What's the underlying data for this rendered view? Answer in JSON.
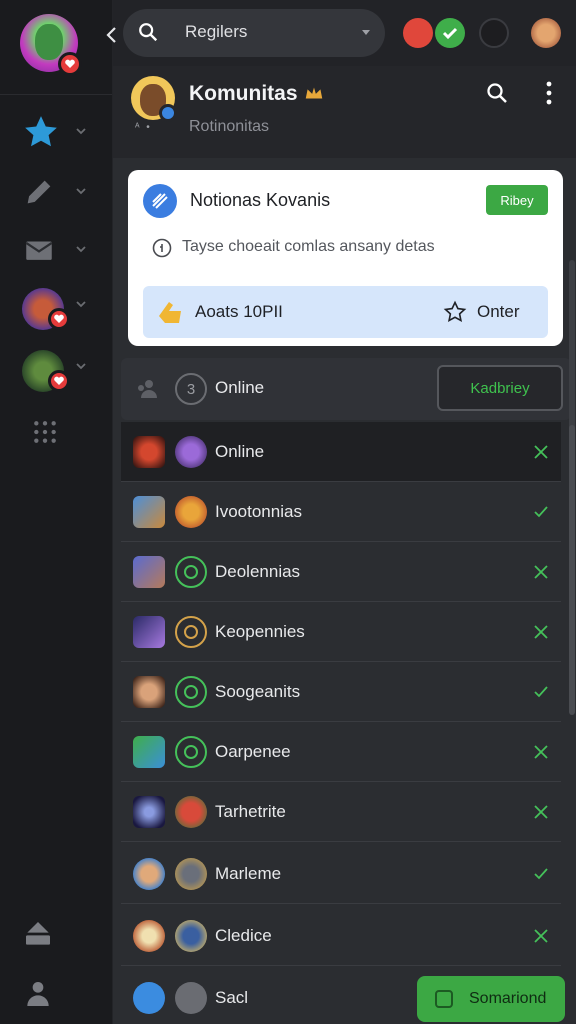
{
  "header": {
    "search_text": "Regilers"
  },
  "community": {
    "title": "Komunitas",
    "subtitle": "Rotinonitas",
    "avatar_dots": "ᴬ •"
  },
  "notification": {
    "title": "Notionas Kovanis",
    "button_label": "Ribey",
    "description": "Tayse choeait comlas ansany detas",
    "bar_left": "Aoats 10PII",
    "bar_right": "Onter"
  },
  "list_header": {
    "circle_number": "3",
    "label": "Online",
    "button_label": "Kadbriey"
  },
  "rows": [
    {
      "name": "Online"
    },
    {
      "name": "Ivootonnias"
    },
    {
      "name": "Deolennias"
    },
    {
      "name": "Keopennies"
    },
    {
      "name": "Soogeanits"
    },
    {
      "name": "Oarpenee"
    },
    {
      "name": "Tarhetrite"
    },
    {
      "name": "Marleme"
    },
    {
      "name": "Cledice"
    },
    {
      "name": "Sacl"
    }
  ],
  "fab": {
    "label": "Somariond"
  },
  "colors": {
    "accent_green": "#3ca844",
    "badge_red": "#e53b3b",
    "card_bar_blue": "#d6e6fb"
  },
  "icons": [
    "search-icon",
    "chevron-left-icon",
    "star-icon",
    "pen-icon",
    "mail-icon",
    "grid-icon",
    "inbox-icon",
    "people-icon",
    "crown-icon",
    "more-icon",
    "info-icon",
    "hand-icon",
    "check-icon"
  ]
}
